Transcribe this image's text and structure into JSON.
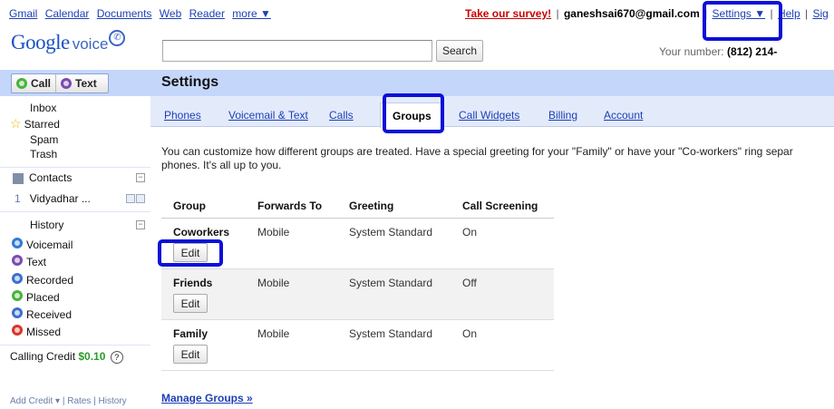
{
  "topnav": {
    "links": [
      "Gmail",
      "Calendar",
      "Documents",
      "Web",
      "Reader",
      "more ▼"
    ],
    "survey": "Take our survey!",
    "divider": "|",
    "email": "ganeshsai670@gmail.com",
    "settings": "Settings ▼",
    "help": "Help",
    "signout": "Sig"
  },
  "logo": {
    "google": "Google",
    "voice": "voice"
  },
  "search": {
    "button": "Search",
    "value": ""
  },
  "your_number": {
    "label": "Your number:",
    "value": "(812) 214-"
  },
  "actions": {
    "call": "Call",
    "text": "Text"
  },
  "page": {
    "title": "Settings"
  },
  "sidebar": {
    "inbox": "Inbox",
    "starred": "Starred",
    "spam": "Spam",
    "trash": "Trash",
    "contacts": "Contacts",
    "contact_count": "1",
    "contact_name": "Vidyadhar ...",
    "history": "History",
    "history_items": [
      "Voicemail",
      "Text",
      "Recorded",
      "Placed",
      "Received",
      "Missed"
    ],
    "credit_label": "Calling Credit",
    "credit_value": "$0.10",
    "credit_help": "?",
    "add_credit": "Add Credit ▾",
    "rates": "Rates",
    "history_link": "History"
  },
  "tabs": [
    "Phones",
    "Voicemail & Text",
    "Calls",
    "Groups",
    "Call Widgets",
    "Billing",
    "Account"
  ],
  "active_tab": "Groups",
  "description": "You can customize how different groups are treated. Have a special greeting for your \"Family\" or have your \"Co-workers\" ring separ phones. It's all up to you.",
  "groups": {
    "columns": [
      "Group",
      "Forwards To",
      "Greeting",
      "Call Screening"
    ],
    "rows": [
      {
        "name": "Coworkers",
        "forwards": "Mobile",
        "greeting": "System Standard",
        "screening": "On",
        "edit": "Edit"
      },
      {
        "name": "Friends",
        "forwards": "Mobile",
        "greeting": "System Standard",
        "screening": "Off",
        "edit": "Edit"
      },
      {
        "name": "Family",
        "forwards": "Mobile",
        "greeting": "System Standard",
        "screening": "On",
        "edit": "Edit"
      }
    ]
  },
  "manage_groups": "Manage Groups »",
  "colors": {
    "band": "#c5d6fb",
    "tabs_bg": "#e3ebfb",
    "link": "#1d3fb5",
    "highlight": "#0a10d8",
    "survey": "#cc0000",
    "credit": "#2a9b2a"
  }
}
